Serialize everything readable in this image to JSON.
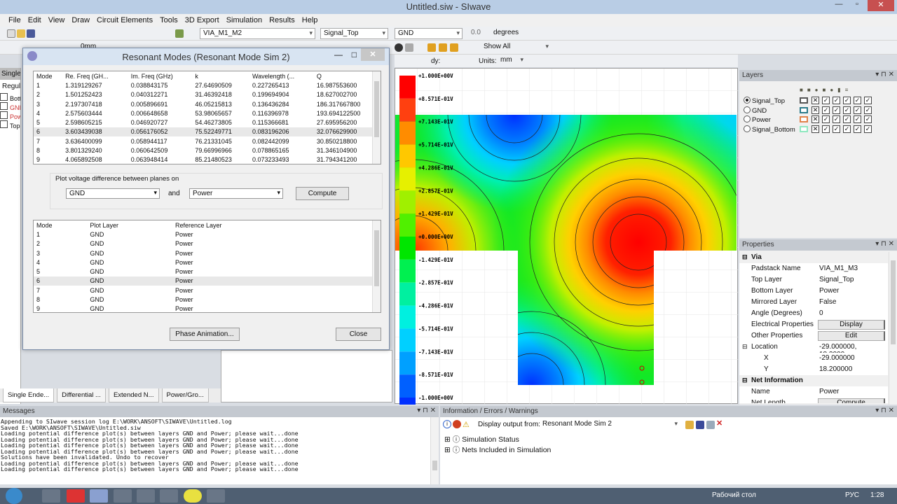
{
  "app": {
    "title": "Untitled.siw - SIwave"
  },
  "menu": [
    "File",
    "Edit",
    "View",
    "Draw",
    "Circuit Elements",
    "Tools",
    "3D Export",
    "Simulation",
    "Results",
    "Help"
  ],
  "toolbar": {
    "padstack": "VIA_M1_M2",
    "layer": "Signal_Top",
    "ref_layer": "GND",
    "angle": "0.0",
    "angle_unit": "degrees",
    "size": "0mm",
    "show": "Show All",
    "dy_label": "dy:",
    "units_label": "Units:",
    "units": "mm"
  },
  "left_panel": {
    "tab": "Single",
    "label": "Regula",
    "items": [
      "Botto",
      "GND",
      "Powe",
      "Top"
    ]
  },
  "bottom_tabs": [
    "Single Ende...",
    "Differential ...",
    "Extended N...",
    "Power/Gro..."
  ],
  "dialog": {
    "title": "Resonant Modes (Resonant Mode Sim 2)",
    "modes_headers": [
      "Mode",
      "Re. Freq (GH...",
      "Im. Freq (GHz)",
      "k",
      "Wavelength (...",
      "Q"
    ],
    "modes": [
      [
        "1",
        "1.319129267",
        "0.038843175",
        "27.64690509",
        "0.227265413",
        "16.987553600"
      ],
      [
        "2",
        "1.501252423",
        "0.040312271",
        "31.46392418",
        "0.199694904",
        "18.627002700"
      ],
      [
        "3",
        "2.197307418",
        "0.005896691",
        "46.05215813",
        "0.136436284",
        "186.317667800"
      ],
      [
        "4",
        "2.575603444",
        "0.006648658",
        "53.98065657",
        "0.116396978",
        "193.694122500"
      ],
      [
        "5",
        "2.598605215",
        "0.046920727",
        "54.46273805",
        "0.115366681",
        "27.695956200"
      ],
      [
        "6",
        "3.603439038",
        "0.056176052",
        "75.52249771",
        "0.083196206",
        "32.076629900"
      ],
      [
        "7",
        "3.636400099",
        "0.058944117",
        "76.21331045",
        "0.082442099",
        "30.850218800"
      ],
      [
        "8",
        "3.801329240",
        "0.060642509",
        "79.66996966",
        "0.078865165",
        "31.346104900"
      ],
      [
        "9",
        "4.065892508",
        "0.063948414",
        "85.21480523",
        "0.073233493",
        "31.794341200"
      ]
    ],
    "plot_label": "Plot voltage difference between planes on",
    "plane1": "GND",
    "and_label": "and",
    "plane2": "Power",
    "compute": "Compute",
    "plot_headers": [
      "Mode",
      "Plot Layer",
      "Reference Layer"
    ],
    "plots": [
      [
        "1",
        "GND",
        "Power"
      ],
      [
        "2",
        "GND",
        "Power"
      ],
      [
        "3",
        "GND",
        "Power"
      ],
      [
        "4",
        "GND",
        "Power"
      ],
      [
        "5",
        "GND",
        "Power"
      ],
      [
        "6",
        "GND",
        "Power"
      ],
      [
        "7",
        "GND",
        "Power"
      ],
      [
        "8",
        "GND",
        "Power"
      ],
      [
        "9",
        "GND",
        "Power"
      ]
    ],
    "phase_animation": "Phase Animation...",
    "close": "Close"
  },
  "colorbar": {
    "labels": [
      "+1.000E+00V",
      "+8.571E-01V",
      "+7.143E-01V",
      "+5.714E-01V",
      "+4.286E-01V",
      "+2.857E-01V",
      "+1.429E-01V",
      "+0.000E+00V",
      "-1.429E-01V",
      "-2.857E-01V",
      "-4.286E-01V",
      "-5.714E-01V",
      "-7.143E-01V",
      "-8.571E-01V",
      "-1.000E+00V"
    ],
    "colors": [
      "#ff0000",
      "#ff4010",
      "#ff8c00",
      "#ffc800",
      "#e6f000",
      "#a0f000",
      "#50f000",
      "#00e600",
      "#00f050",
      "#00f0a0",
      "#00f0e0",
      "#00d0ff",
      "#00a0ff",
      "#0060ff",
      "#0030ff"
    ]
  },
  "layers": {
    "title": "Layers",
    "items": [
      {
        "name": "Signal_Top",
        "color": "#555555",
        "selected": true
      },
      {
        "name": "GND",
        "color": "#2b7a8a",
        "selected": false
      },
      {
        "name": "Power",
        "color": "#e0824a",
        "selected": false
      },
      {
        "name": "Signal_Bottom",
        "color": "#90e8c0",
        "selected": false
      }
    ]
  },
  "properties": {
    "title": "Properties",
    "rows": [
      {
        "k": "Via",
        "group": true
      },
      {
        "k": "Padstack Name",
        "v": "VIA_M1_M3"
      },
      {
        "k": "Top Layer",
        "v": "Signal_Top"
      },
      {
        "k": "Bottom Layer",
        "v": "Power"
      },
      {
        "k": "Mirrored Layer",
        "v": "False"
      },
      {
        "k": "Angle (Degrees)",
        "v": "0"
      },
      {
        "k": "Electrical Properties",
        "v": "Display",
        "button": true
      },
      {
        "k": "Other Properties",
        "v": "Edit",
        "button": true
      },
      {
        "k": "Location",
        "v": "-29.000000, 18.2000...",
        "group2": true
      },
      {
        "k": "X",
        "v": "-29.000000",
        "indent": true
      },
      {
        "k": "Y",
        "v": "18.200000",
        "indent": true
      },
      {
        "k": "Net Information",
        "group": true
      },
      {
        "k": "Name",
        "v": "Power"
      },
      {
        "k": "Net Length",
        "v": "Compute",
        "button": true
      }
    ]
  },
  "messages": {
    "title": "Messages",
    "lines": [
      "Appending to SIwave session log E:\\WORK\\ANSOFT\\SIWAVE\\Untitled.log",
      "Saved E:\\WORK\\ANSOFT\\SIWAVE\\Untitled.siw",
      "Loading potential difference plot(s) between layers GND and Power; please wait...done",
      "Loading potential difference plot(s) between layers GND and Power; please wait...done",
      "Loading potential difference plot(s) between layers GND and Power; please wait...done",
      "Loading potential difference plot(s) between layers GND and Power; please wait...done",
      "Solutions have been invalidated. Undo to recover",
      "Loading potential difference plot(s) between layers GND and Power; please wait...done",
      "Loading potential difference plot(s) between layers GND and Power; please wait...done"
    ]
  },
  "info": {
    "title": "Information / Errors / Warnings",
    "display_label": "Display output from:",
    "source": "Resonant Mode Sim 2",
    "items": [
      "Simulation Status",
      "Nets Included in Simulation"
    ]
  },
  "taskbar": {
    "desktop": "Рабочий стол",
    "lang": "РУС",
    "time": "1:28"
  }
}
